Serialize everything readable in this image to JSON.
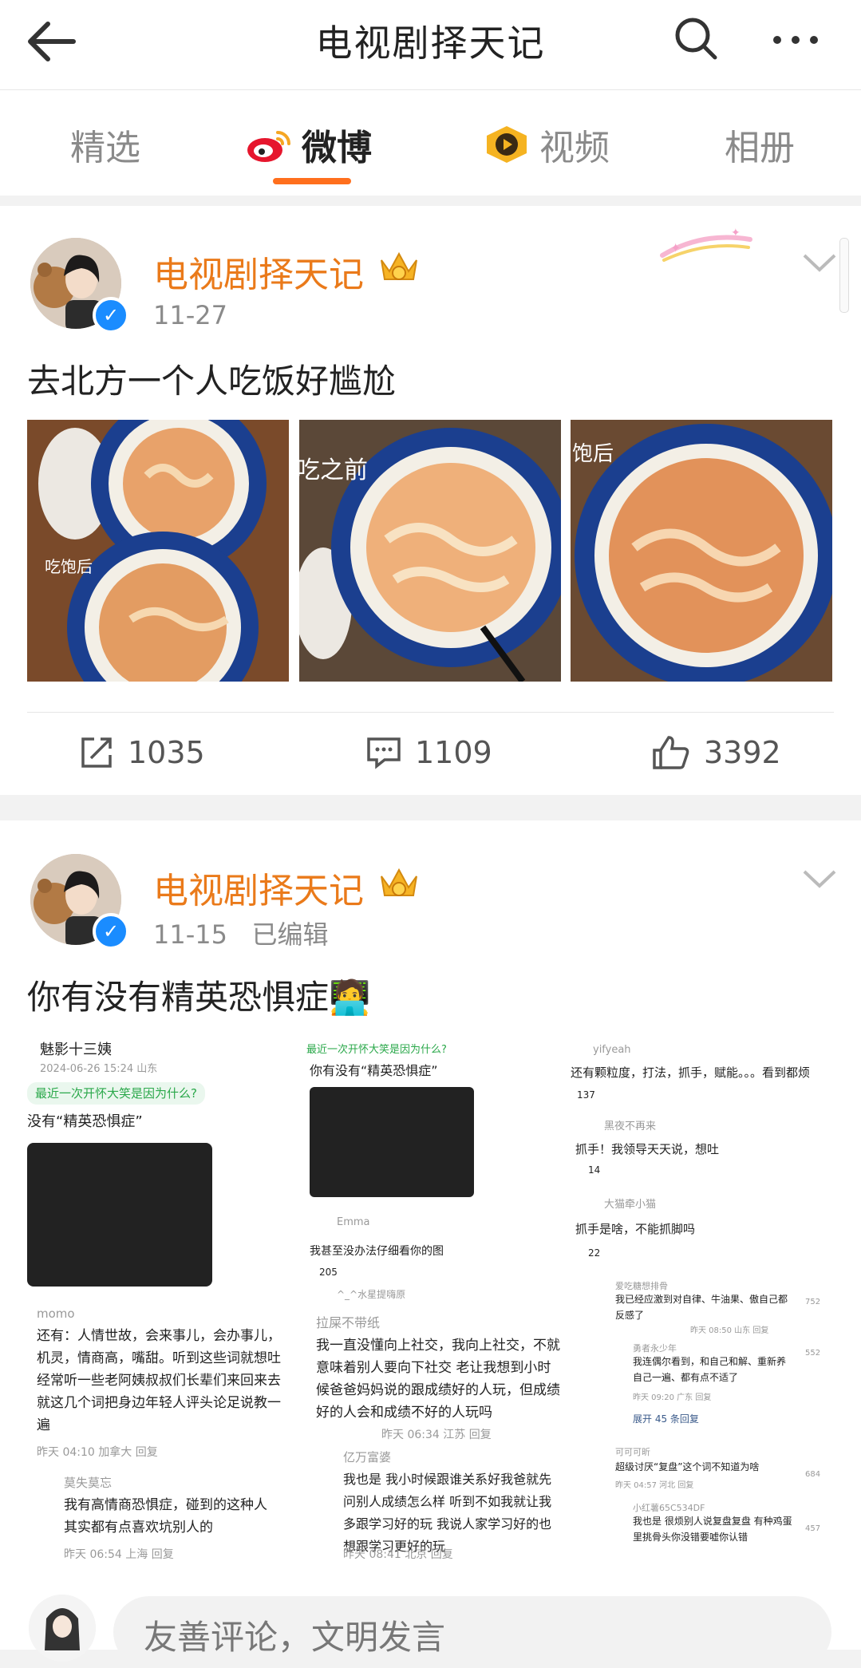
{
  "header": {
    "title": "电视剧择天记"
  },
  "tabs": [
    {
      "label": "精选",
      "active": false
    },
    {
      "label": "微博",
      "active": true
    },
    {
      "label": "视频",
      "active": false
    },
    {
      "label": "相册",
      "active": false
    }
  ],
  "posts": [
    {
      "author": "电视剧择天记",
      "date": "11-27",
      "edited": "",
      "text": "去北方一个人吃饭好尴尬",
      "image_labels": [
        "吃饱后",
        "吃之前",
        "饱后"
      ],
      "reposts": "1035",
      "comments": "1109",
      "likes": "3392"
    },
    {
      "author": "电视剧择天记",
      "date": "11-15",
      "edited": "已编辑",
      "text": "你有没有精英恐惧症",
      "text_emoji": "🧑‍💻"
    }
  ],
  "screenshots": {
    "left": {
      "user": "魅影十三姨",
      "time": "2024-06-26 15:24 山东",
      "topic": "最近一次开怀大笑是因为什么?",
      "question": "没有“精英恐惧症”",
      "reply_user": "momo",
      "reply": "还有：人情世故，会来事儿，会办事儿，机灵，情商高，嘴甜。听到这些词就想吐 经常听一些老阿姨叔叔们长辈们来回来去就这几个词把身边年轻人评头论足说教一遍",
      "reply_meta": "昨天 04:10 加拿大  回复",
      "sub_user": "莫失莫忘",
      "sub": "我有高情商恐惧症，碰到的这种人其实都有点喜欢坑别人的",
      "sub_meta": "昨天 06:54 上海  回复"
    },
    "middle": {
      "topic": "最近一次开怀大笑是因为什么?",
      "question": "你有没有“精英恐惧症”",
      "user1": "Emma",
      "text1": "我甚至没办法仔细看你的图",
      "likes1": "205",
      "user2": "^_^水星提嗨原",
      "reply_user": "拉屎不带纸",
      "reply": "我一直没懂向上社交，我向上社交，不就意味着别人要向下社交 老让我想到小时候爸爸妈妈说的跟成绩好的人玩，但成绩好的人会和成绩不好的人玩吗",
      "reply_meta": "昨天 06:34 江苏  回复",
      "sub_user": "亿万富婆",
      "sub": "我也是 我小时候跟谁关系好我爸就先问别人成绩怎么样 听到不如我就让我多跟学习好的玩 我说人家学习好的也想跟学习更好的玩",
      "sub_meta": "昨天 08:41 北京  回复"
    },
    "right": {
      "user1": "yifyeah",
      "text1": "还有颗粒度，打法，抓手，赋能。。。看到都烦",
      "likes1": "137",
      "user2": "黑夜不再来",
      "text2": "抓手！我领导天天说，想吐",
      "likes2": "14",
      "user3": "大猫牵小猫",
      "text3": "抓手是啥，不能抓脚吗",
      "likes3": "22",
      "c1_user": "爱吃糖想排骨",
      "c1": "我已经应激到对自律、牛油果、傲自己都反感了",
      "c1_meta": "昨天 08:50 山东  回复",
      "c1_likes": "752",
      "c2_user": "勇者永少年",
      "c2": "我连偶尔看到，和自己和解、重新养自己一遍、都有点不适了",
      "c2_meta": "昨天 09:20 广东  回复",
      "c2_likes": "552",
      "expand": "展开 45 条回复",
      "c3_user": "可可可昕",
      "c3": "超级讨厌“复盘”这个词不知道为啥",
      "c3_meta": "昨天 04:57 河北  回复",
      "c3_likes": "684",
      "c4_user": "小红薯65C534DF",
      "c4": "我也是 很烦别人说复盘复盘 有种鸡蛋里挑骨头你没错要嘘你认错",
      "c4_likes": "457"
    }
  },
  "comment_bar": {
    "placeholder": "友善评论，文明发言"
  },
  "colors": {
    "brand_orange": "#ea7a1a",
    "tab_underline": "#ff6f1d",
    "verified_blue": "#1a8cff"
  }
}
